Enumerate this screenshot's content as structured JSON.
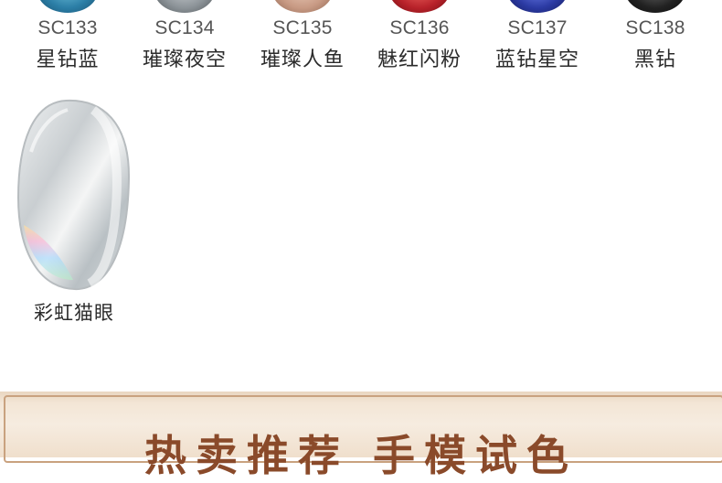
{
  "swatches": [
    {
      "code": "SC133",
      "name": "星钻蓝",
      "color": "#3a8fb5"
    },
    {
      "code": "SC134",
      "name": "璀璨夜空",
      "color": "#8e949a"
    },
    {
      "code": "SC135",
      "name": "璀璨人鱼",
      "color": "#c9a08a"
    },
    {
      "code": "SC136",
      "name": "魅红闪粉",
      "color": "#b3262a"
    },
    {
      "code": "SC137",
      "name": "蓝钻星空",
      "color": "#2a3c9a"
    },
    {
      "code": "SC138",
      "name": "黑钻",
      "color": "#2a2a2a"
    }
  ],
  "featured": {
    "name": "彩虹猫眼",
    "color": "#cfd4d6"
  },
  "banner": {
    "title": "热卖推荐 手模试色"
  }
}
